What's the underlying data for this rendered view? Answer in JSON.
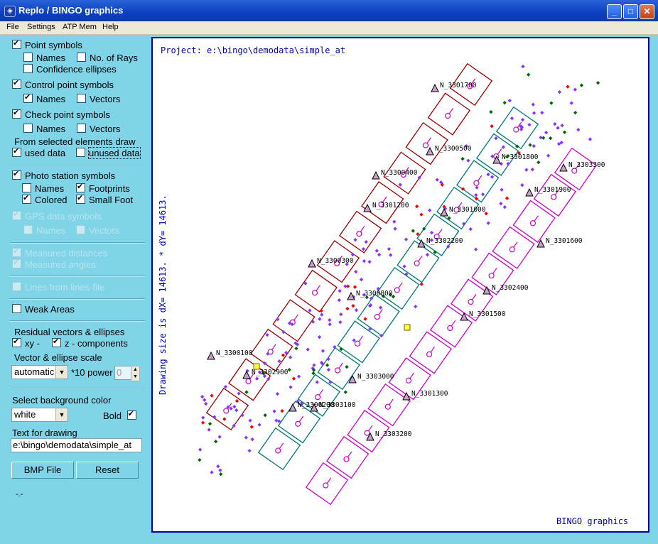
{
  "window": {
    "title": "Replo / BINGO graphics",
    "minimize": "_",
    "maximize": "□",
    "close": "✕",
    "app_icon": "bingo-app-icon"
  },
  "menu": [
    "File",
    "Settings",
    "ATP Mem",
    "Help"
  ],
  "panel": {
    "point_symbols": {
      "label": "Point symbols",
      "checked": true
    },
    "names_1": {
      "label": "Names",
      "checked": false
    },
    "no_of_rays": {
      "label": "No. of Rays",
      "checked": false
    },
    "confidence_ellipses": {
      "label": "Confidence ellipses",
      "checked": false
    },
    "control_point_symbols": {
      "label": "Control point symbols",
      "checked": true
    },
    "names_2": {
      "label": "Names",
      "checked": true
    },
    "vectors_2": {
      "label": "Vectors",
      "checked": false
    },
    "check_point_symbols": {
      "label": "Check point symbols",
      "checked": true
    },
    "names_3": {
      "label": "Names",
      "checked": false
    },
    "vectors_3": {
      "label": "Vectors",
      "checked": false
    },
    "from_selected": "From selected elements draw",
    "used_data": {
      "label": "used data",
      "checked": true
    },
    "unused_data": {
      "label": "unused data",
      "checked": false
    },
    "photo_station_symbols": {
      "label": "Photo station symbols",
      "checked": true
    },
    "names_4": {
      "label": "Names",
      "checked": false
    },
    "footprints": {
      "label": "Footprints",
      "checked": true
    },
    "colored": {
      "label": "Colored",
      "checked": true
    },
    "small_foot": {
      "label": "Small Foot",
      "checked": true
    },
    "gps_data_symbols": {
      "label": "GPS data symbols",
      "checked": true
    },
    "names_5": {
      "label": "Names",
      "checked": false
    },
    "vectors_5": {
      "label": "Vectors",
      "checked": false
    },
    "measured_distances": {
      "label": "Measured distances",
      "checked": true
    },
    "measured_angles": {
      "label": "Measured angles",
      "checked": true
    },
    "lines_from_file": {
      "label": "Lines from lines-file",
      "checked": false
    },
    "weak_areas": {
      "label": "Weak Areas",
      "checked": false
    },
    "residual_heading": "Residual vectors & ellipses",
    "xy": {
      "label": "xy -",
      "checked": true
    },
    "z_components": {
      "label": "z - components",
      "checked": true
    },
    "vector_scale_label": "Vector & ellipse scale",
    "scale_select": "automatic",
    "power_label": "*10 power",
    "power_value": "0",
    "background_label": "Select background color",
    "background_select": "white",
    "bold": {
      "label": "Bold",
      "checked": true
    },
    "text_label": "Text for drawing",
    "text_value": "e:\\bingo\\demodata\\simple_at",
    "bmp_button": "BMP File",
    "reset_button": "Reset",
    "status": "-.-"
  },
  "drawing": {
    "project": "Project: e:\\bingo\\demodata\\simple_at",
    "size_text": "Drawing size is dX= 14613. * dY= 14613.",
    "footer": "BINGO graphics",
    "colors": {
      "strip1": "#990000",
      "strip2": "#007777",
      "strip3": "#cc00cc",
      "symbol": "#cc00cc",
      "tie": "#8833ff",
      "control": "#006600",
      "red": "#ee0000",
      "label": "#0000aa"
    },
    "points": [
      {
        "name": "N_3301700"
      },
      {
        "name": "N_3300500"
      },
      {
        "name": "N_3301800"
      },
      {
        "name": "N_3303300"
      },
      {
        "name": "N_3300400"
      },
      {
        "name": "N_3301900"
      },
      {
        "name": "N_3301200"
      },
      {
        "name": "N_3301000"
      },
      {
        "name": "N_3302200"
      },
      {
        "name": "N_3301600"
      },
      {
        "name": "N_3300300"
      },
      {
        "name": "N_3302400"
      },
      {
        "name": "N_3300800"
      },
      {
        "name": "N_3301500"
      },
      {
        "name": "N_3300100"
      },
      {
        "name": "N_3302900"
      },
      {
        "name": "N_3303000"
      },
      {
        "name": "N_3301300"
      },
      {
        "name": "N_3303100"
      },
      {
        "name": "N_3300200"
      },
      {
        "name": "N_3303200"
      }
    ]
  }
}
